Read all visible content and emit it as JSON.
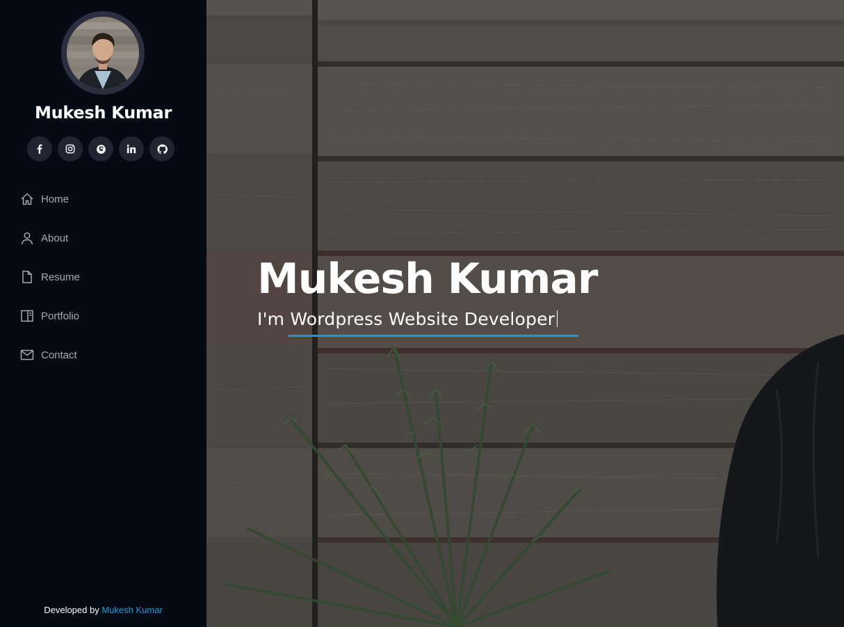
{
  "profile": {
    "name": "Mukesh Kumar",
    "avatar_icon": "profile-photo"
  },
  "social": [
    {
      "name": "facebook",
      "icon": "facebook-icon"
    },
    {
      "name": "instagram",
      "icon": "instagram-icon"
    },
    {
      "name": "skype",
      "icon": "skype-icon"
    },
    {
      "name": "linkedin",
      "icon": "linkedin-icon"
    },
    {
      "name": "github",
      "icon": "github-icon"
    }
  ],
  "nav": {
    "items": [
      {
        "label": "Home",
        "icon": "home-icon"
      },
      {
        "label": "About",
        "icon": "user-icon"
      },
      {
        "label": "Resume",
        "icon": "file-icon"
      },
      {
        "label": "Portfolio",
        "icon": "book-icon"
      },
      {
        "label": "Contact",
        "icon": "envelope-icon"
      }
    ]
  },
  "footer": {
    "prefix": "Developed by",
    "author": "Mukesh Kumar"
  },
  "hero": {
    "title": "Mukesh Kumar",
    "subtitle": "I'm Wordpress Website Developer"
  },
  "colors": {
    "sidebar_bg": "#040b14",
    "accent": "#149ddd",
    "nav_text": "#a8a9b4",
    "social_bg": "#212431"
  }
}
